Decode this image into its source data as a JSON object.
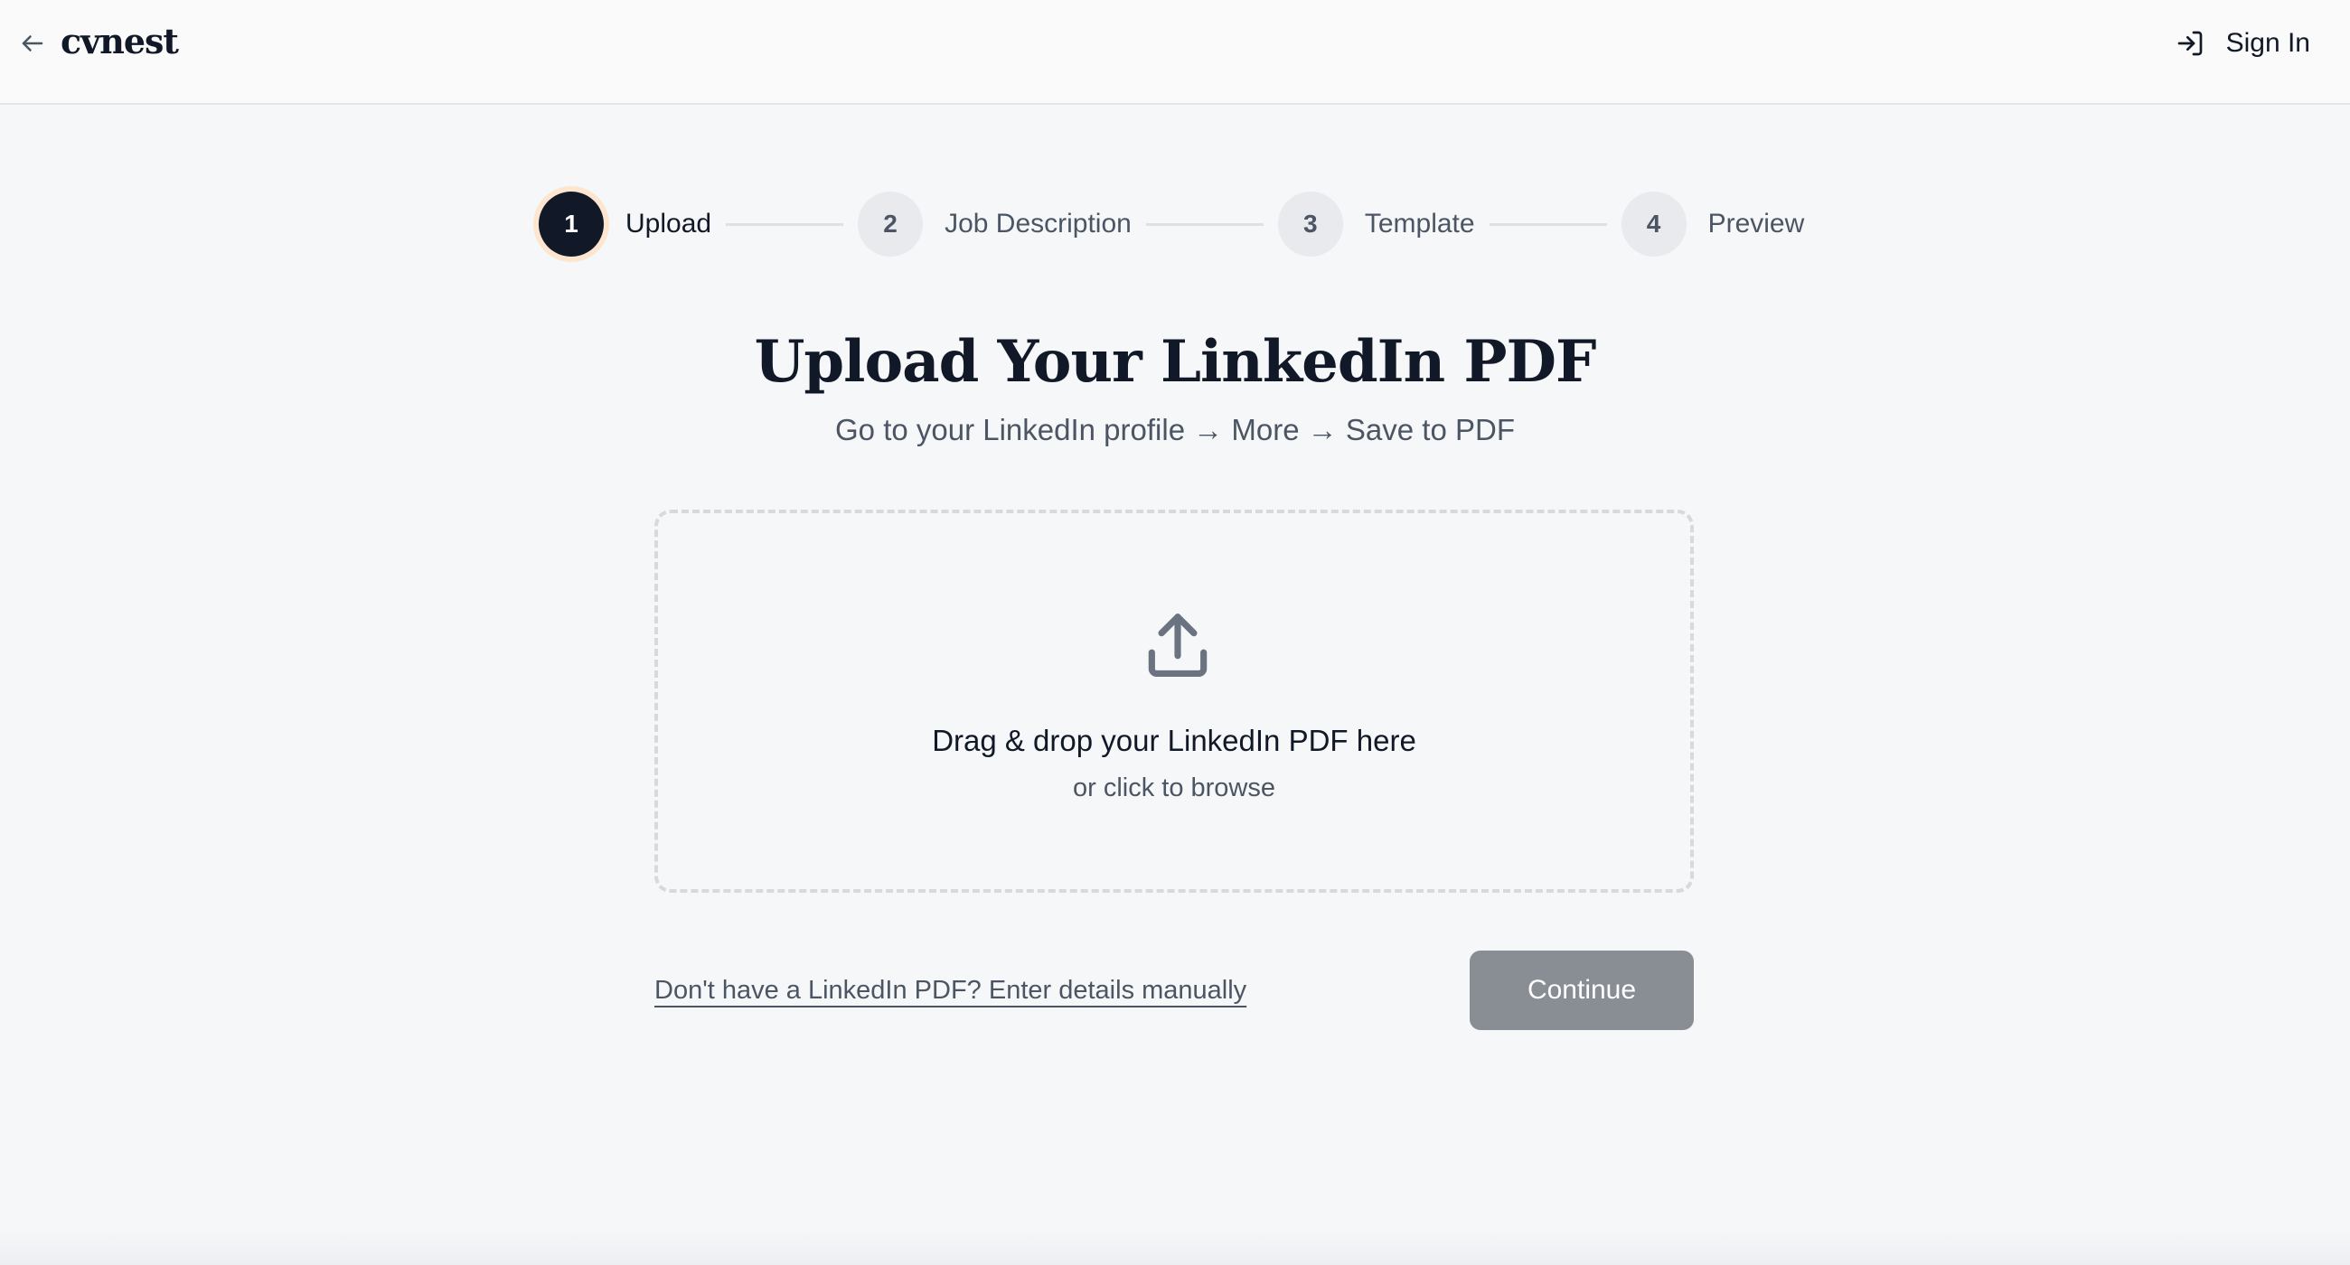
{
  "header": {
    "back_icon": "arrow-left-icon",
    "logo": "cvnest",
    "signin_icon": "sign-in-icon",
    "signin_label": "Sign In"
  },
  "stepper": {
    "steps": [
      {
        "number": "1",
        "label": "Upload",
        "active": true
      },
      {
        "number": "2",
        "label": "Job Description",
        "active": false
      },
      {
        "number": "3",
        "label": "Template",
        "active": false
      },
      {
        "number": "4",
        "label": "Preview",
        "active": false
      }
    ]
  },
  "main": {
    "title": "Upload Your LinkedIn PDF",
    "subtitle": "Go to your LinkedIn profile → More → Save to PDF"
  },
  "dropzone": {
    "icon": "upload-icon",
    "title": "Drag & drop your LinkedIn PDF here",
    "subtitle": "or click to browse"
  },
  "actions": {
    "manual_link": "Don't have a LinkedIn PDF? Enter details manually",
    "continue_label": "Continue"
  },
  "colors": {
    "background": "#f6f7f9",
    "active_step": "#111827",
    "active_step_ring": "#fde6cf",
    "continue_disabled": "#898d94"
  }
}
